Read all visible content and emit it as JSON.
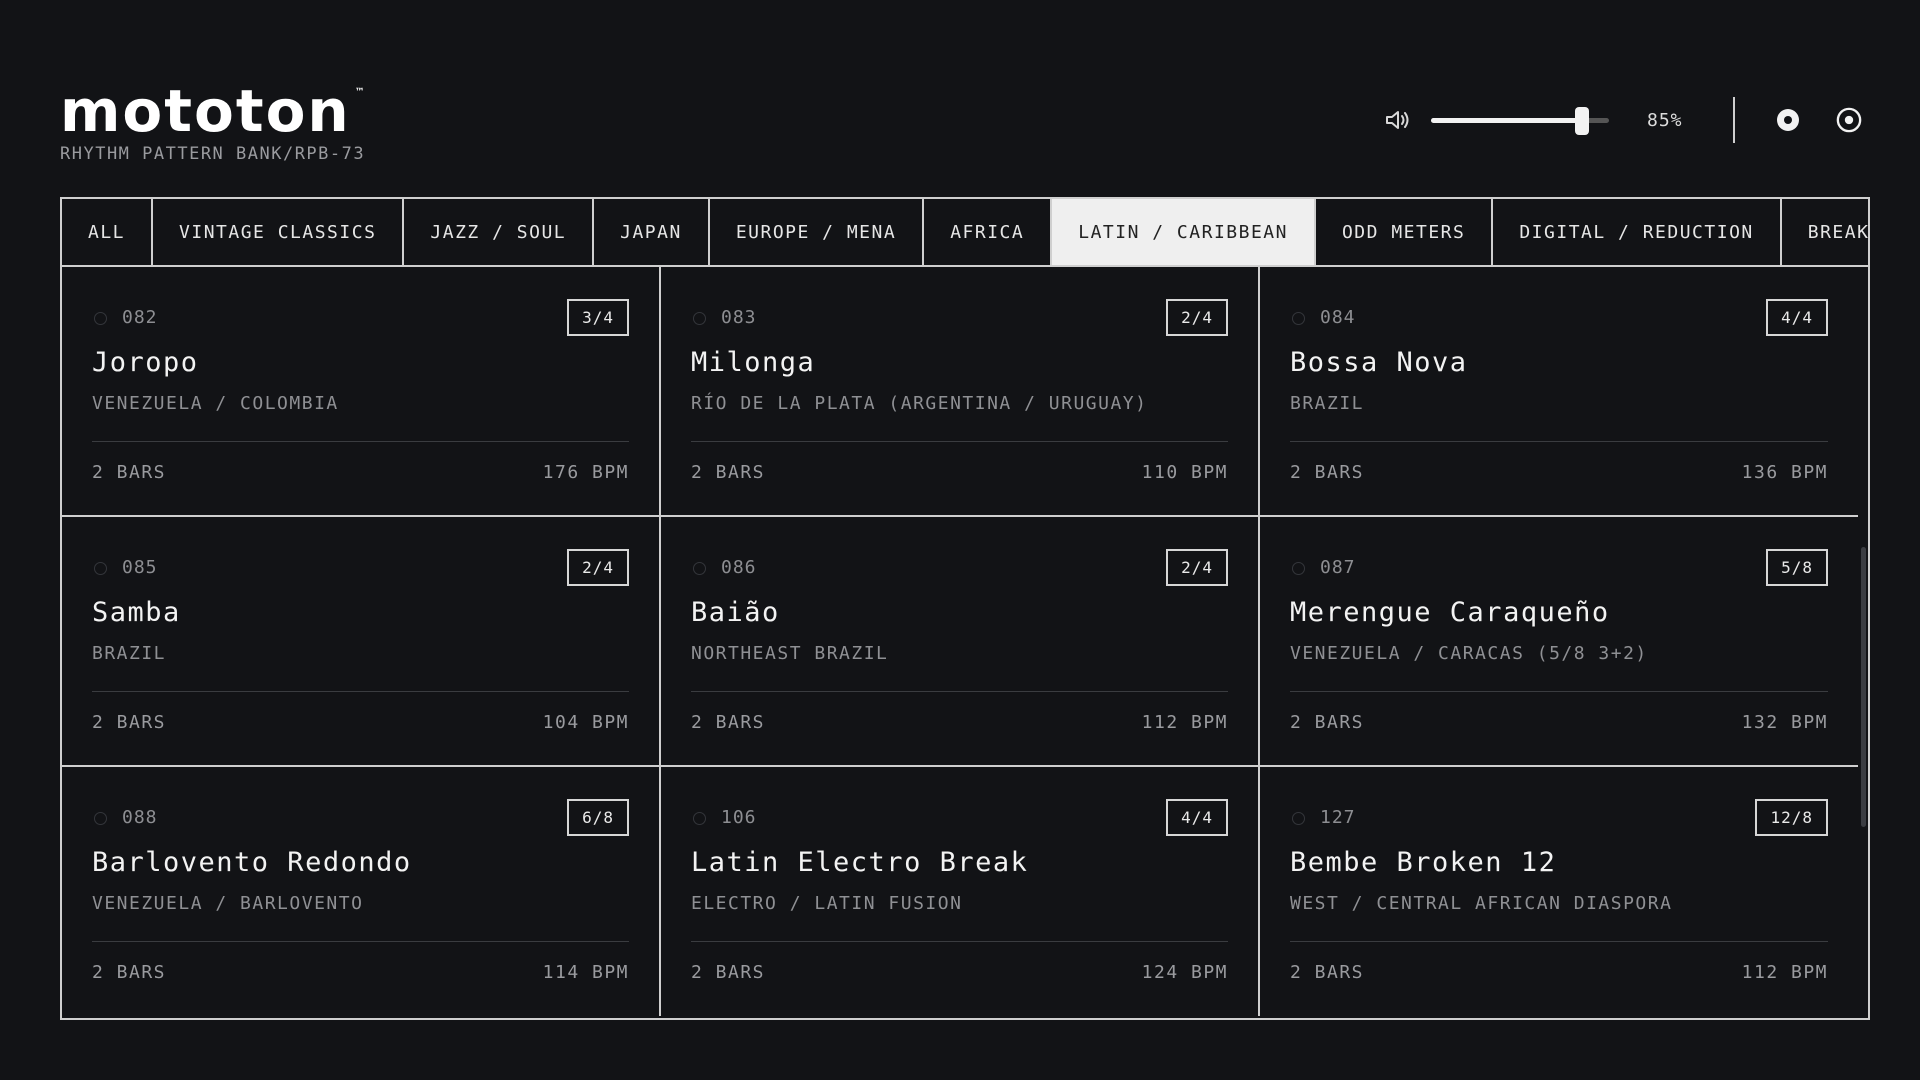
{
  "brand": {
    "logo": "mototon",
    "trademark": "™",
    "subtitle": "RHYTHM PATTERN BANK/RPB-73"
  },
  "volume": {
    "level": 85,
    "label": "85%",
    "icon": "speaker-icon"
  },
  "header_icons": [
    "record-icon",
    "target-icon"
  ],
  "tabs": [
    {
      "label": "ALL"
    },
    {
      "label": "VINTAGE CLASSICS"
    },
    {
      "label": "JAZZ / SOUL"
    },
    {
      "label": "JAPAN"
    },
    {
      "label": "EUROPE / MENA"
    },
    {
      "label": "AFRICA"
    },
    {
      "label": "LATIN / CARIBBEAN",
      "active": true
    },
    {
      "label": "ODD METERS"
    },
    {
      "label": "DIGITAL / REDUCTION"
    },
    {
      "label": "BREAK"
    }
  ],
  "patterns": [
    {
      "num": "082",
      "meter": "3/4",
      "name": "Joropo",
      "region": "VENEZUELA / COLOMBIA",
      "bars": "2 BARS",
      "bpm": "176 BPM"
    },
    {
      "num": "083",
      "meter": "2/4",
      "name": "Milonga",
      "region": "RÍO DE LA PLATA (ARGENTINA / URUGUAY)",
      "bars": "2 BARS",
      "bpm": "110 BPM"
    },
    {
      "num": "084",
      "meter": "4/4",
      "name": "Bossa Nova",
      "region": "BRAZIL",
      "bars": "2 BARS",
      "bpm": "136 BPM"
    },
    {
      "num": "085",
      "meter": "2/4",
      "name": "Samba",
      "region": "BRAZIL",
      "bars": "2 BARS",
      "bpm": "104 BPM"
    },
    {
      "num": "086",
      "meter": "2/4",
      "name": "Baião",
      "region": "NORTHEAST BRAZIL",
      "bars": "2 BARS",
      "bpm": "112 BPM"
    },
    {
      "num": "087",
      "meter": "5/8",
      "name": "Merengue Caraqueño",
      "region": "VENEZUELA / CARACAS (5/8 3+2)",
      "bars": "2 BARS",
      "bpm": "132 BPM"
    },
    {
      "num": "088",
      "meter": "6/8",
      "name": "Barlovento Redondo",
      "region": "VENEZUELA / BARLOVENTO",
      "bars": "2 BARS",
      "bpm": "114 BPM"
    },
    {
      "num": "106",
      "meter": "4/4",
      "name": "Latin Electro Break",
      "region": "ELECTRO / LATIN FUSION",
      "bars": "2 BARS",
      "bpm": "124 BPM"
    },
    {
      "num": "127",
      "meter": "12/8",
      "name": "Bembe Broken 12",
      "region": "WEST / CENTRAL AFRICAN DIASPORA",
      "bars": "2 BARS",
      "bpm": "112 BPM"
    }
  ]
}
